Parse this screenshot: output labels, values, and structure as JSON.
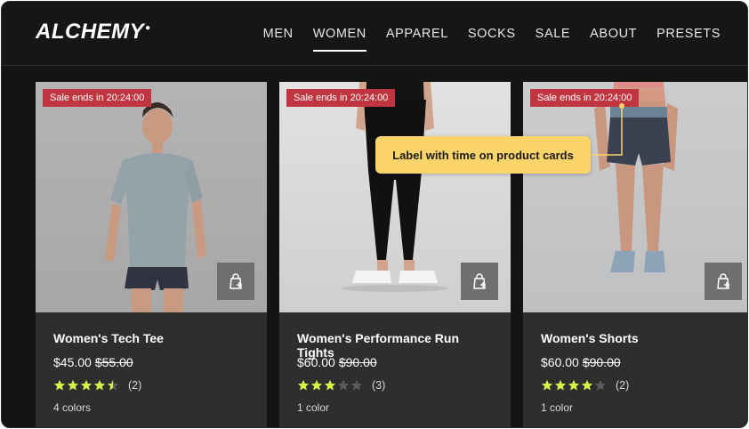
{
  "header": {
    "logo": "ALCHEMY",
    "nav": [
      "MEN",
      "WOMEN",
      "APPAREL",
      "SOCKS",
      "SALE",
      "ABOUT",
      "PRESETS"
    ],
    "active_nav": "WOMEN"
  },
  "colors": {
    "background": "#141414",
    "card": "#2e2e2e",
    "sale_badge": "#c0353f",
    "star_filled": "#d7f04a",
    "star_empty": "#5b5b5b",
    "callout": "#fdd46a"
  },
  "products": [
    {
      "badge": "Sale ends in 20:24:00",
      "name": "Women's Tech Tee",
      "price": "$45.00",
      "was_price": "$55.00",
      "rating": 4.5,
      "review_count": "(2)",
      "colors": "4 colors",
      "cart_icon": "bag-plus-icon"
    },
    {
      "badge": "Sale ends in 20:24:00",
      "name": "Women's Performance Run Tights",
      "price": "$60.00",
      "was_price": "$90.00",
      "rating": 3,
      "review_count": "(3)",
      "colors": "1 color",
      "cart_icon": "bag-plus-icon"
    },
    {
      "badge": "Sale ends in 20:24:00",
      "name": "Women's Shorts",
      "price": "$60.00",
      "was_price": "$90.00",
      "rating": 4,
      "review_count": "(2)",
      "colors": "1 color",
      "cart_icon": "bag-plus-icon"
    }
  ],
  "annotation": {
    "text": "Label with time on product cards"
  }
}
